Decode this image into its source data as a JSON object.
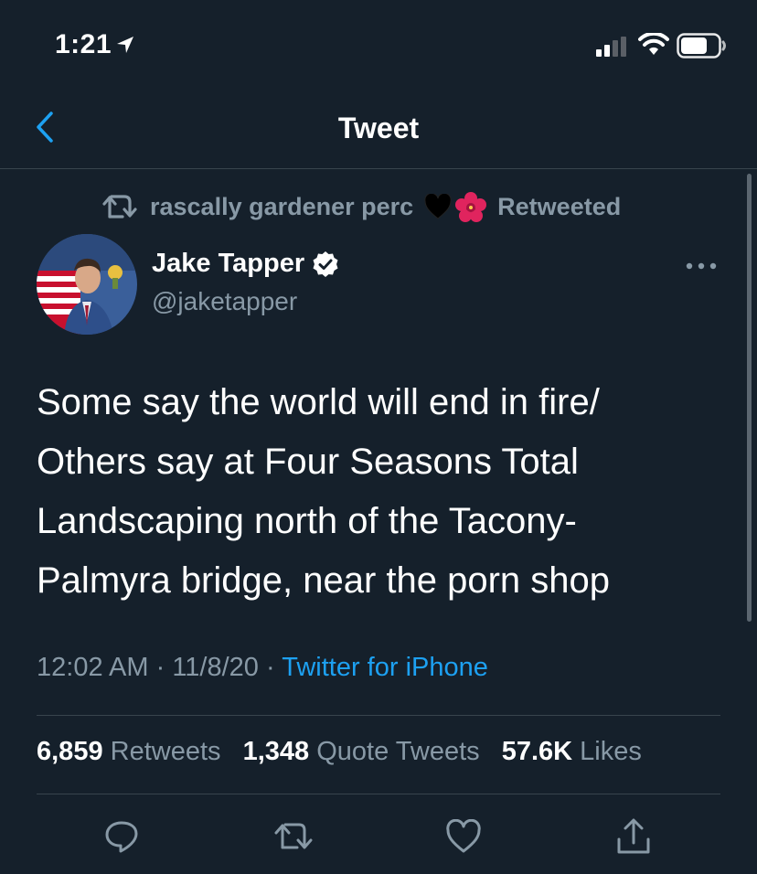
{
  "status_bar": {
    "time": "1:21"
  },
  "nav": {
    "title": "Tweet"
  },
  "retweet_context": {
    "retweeter": "rascally gardener perc",
    "label": "Retweeted"
  },
  "author": {
    "name": "Jake Tapper",
    "handle": "@jaketapper"
  },
  "tweet": {
    "lines": [
      "Some say the world will end in fire/",
      "Others say at Four Seasons Total",
      "Landscaping north of the Tacony-",
      "Palmyra bridge, near the porn shop"
    ],
    "time": "12:02 AM",
    "date": "11/8/20",
    "separator": "·",
    "source": "Twitter for iPhone"
  },
  "stats": {
    "retweets": {
      "count": "6,859",
      "label": "Retweets"
    },
    "quotes": {
      "count": "1,348",
      "label": "Quote Tweets"
    },
    "likes": {
      "count": "57.6K",
      "label": "Likes"
    }
  },
  "colors": {
    "background": "#15202b",
    "accent": "#1da1f2",
    "secondary_text": "#8899a6",
    "divider": "#38444d"
  },
  "icons": {
    "location": "location-arrow-icon",
    "signal": "cellular-signal-icon",
    "wifi": "wifi-icon",
    "battery": "battery-icon",
    "back": "chevron-left-icon",
    "retweet": "retweet-icon",
    "verified": "verified-badge-icon",
    "more": "more-dots-icon",
    "reply": "reply-bubble-icon",
    "share": "share-icon"
  }
}
